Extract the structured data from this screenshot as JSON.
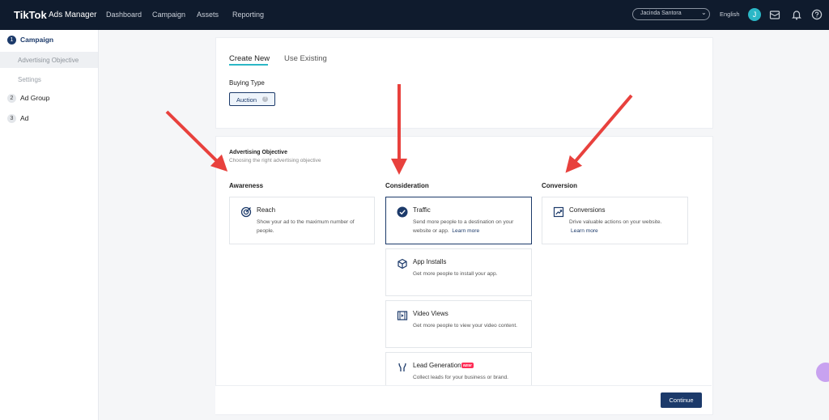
{
  "topbar": {
    "brand": "TikTok",
    "brand_sub": "Ads Manager",
    "nav": [
      "Dashboard",
      "Campaign",
      "Assets",
      "Reporting"
    ],
    "account": "Jacinda Santora",
    "language": "English",
    "avatar_initial": "J"
  },
  "sidebar": {
    "steps": [
      {
        "num": "1",
        "label": "Campaign"
      },
      {
        "label": "Advertising Objective"
      },
      {
        "label": "Settings"
      },
      {
        "num": "2",
        "label": "Ad Group"
      },
      {
        "num": "3",
        "label": "Ad"
      }
    ]
  },
  "tabs": {
    "create_new": "Create New",
    "use_existing": "Use Existing"
  },
  "buying_type": {
    "label": "Buying Type",
    "value": "Auction"
  },
  "objective": {
    "title": "Advertising Objective",
    "subtitle": "Choosing the right advertising objective",
    "columns": [
      "Awareness",
      "Consideration",
      "Conversion"
    ],
    "reach": {
      "title": "Reach",
      "desc": "Show your ad to the maximum number of people."
    },
    "traffic": {
      "title": "Traffic",
      "desc": "Send more people to a destination on your website or app.",
      "link": "Learn more"
    },
    "app_installs": {
      "title": "App Installs",
      "desc": "Get more people to install your app."
    },
    "video_views": {
      "title": "Video Views",
      "desc": "Get more people to view your video content."
    },
    "lead_generation": {
      "title": "Lead Generation",
      "badge": "NEW",
      "desc": "Collect leads for your business or brand."
    },
    "conversions": {
      "title": "Conversions",
      "desc": "Drive valuable actions on your website.",
      "link": "Learn more"
    }
  },
  "footer": {
    "continue": "Continue"
  },
  "colors": {
    "navy": "#1c3a6a",
    "teal": "#2bb7c6",
    "arrow": "#e8413d",
    "topbar": "#0f1b2d"
  }
}
